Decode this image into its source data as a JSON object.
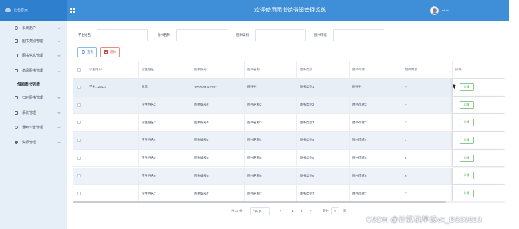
{
  "header": {
    "brand": "后台首页",
    "title": "欢迎使用图书馆借阅管理系统",
    "username": "admin",
    "grid_icon": "grid-icon",
    "avatar_icon": "user-avatar"
  },
  "sidebar": {
    "items": [
      {
        "label": "系统用户",
        "icon": "person-icon"
      },
      {
        "label": "图书类别管理",
        "icon": "edit-icon"
      },
      {
        "label": "图书信息管理",
        "icon": "edit-icon"
      },
      {
        "label": "借阅图书管理",
        "icon": "edit-icon"
      },
      {
        "label": "借阅图书列表",
        "icon": ""
      },
      {
        "label": "归还图书管理",
        "icon": "edit-icon"
      },
      {
        "label": "系统管理",
        "icon": "image-icon"
      },
      {
        "label": "通知公告管理",
        "icon": "info-icon"
      },
      {
        "label": "资源管理",
        "icon": "pin-icon"
      }
    ]
  },
  "search": {
    "fields": [
      {
        "label": "学生姓名",
        "value": ""
      },
      {
        "label": "图书名称",
        "value": ""
      },
      {
        "label": "图书类别",
        "value": ""
      },
      {
        "label": "图书作者",
        "value": ""
      }
    ],
    "search_label": "查询",
    "delete_label": "删除"
  },
  "table": {
    "columns": [
      "学生用户",
      "学生姓名",
      "图书编号",
      "图书名称",
      "图书类别",
      "图书作者",
      "借阅数量",
      "操作"
    ],
    "rows": [
      {
        "user": "学生:123123",
        "name": "张三",
        "code": "1707034462797",
        "book": "柳寻谷",
        "category": "图书类别1",
        "author": "柳寻谷",
        "qty": "3"
      },
      {
        "user": "",
        "name": "学生姓名2",
        "code": "图书编号2",
        "book": "图书名称2",
        "category": "图书类别2",
        "author": "图书作者2",
        "qty": "2"
      },
      {
        "user": "",
        "name": "学生姓名3",
        "code": "图书编号3",
        "book": "图书名称3",
        "category": "图书类别3",
        "author": "图书作者3",
        "qty": "3"
      },
      {
        "user": "",
        "name": "学生姓名4",
        "code": "图书编号4",
        "book": "图书名称4",
        "category": "图书类别4",
        "author": "图书作者4",
        "qty": "4"
      },
      {
        "user": "",
        "name": "学生姓名5",
        "code": "图书编号5",
        "book": "图书名称5",
        "category": "图书类别5",
        "author": "图书作者5",
        "qty": "5"
      },
      {
        "user": "",
        "name": "学生姓名6",
        "code": "图书编号6",
        "book": "图书名称6",
        "category": "图书类别6",
        "author": "图书作者6",
        "qty": "6"
      },
      {
        "user": "",
        "name": "学生姓名7",
        "code": "图书编号7",
        "book": "图书名称7",
        "category": "图书类别7",
        "author": "图书作者7",
        "qty": "7"
      }
    ],
    "detail_label": "详情"
  },
  "pager": {
    "total": "共 13 条",
    "size": "7条/页",
    "prev": "‹",
    "pages": [
      "1",
      "2"
    ],
    "next": "›",
    "goto": "前往",
    "current": "1",
    "page_unit": "页"
  },
  "watermark": "CSDN @计算机毕设vx_BS30813",
  "colors": {
    "topbar": "#3f8fd8",
    "sidebar": "#e6eef8",
    "accent": "#3c7fd6",
    "danger": "#d9463c",
    "success": "#4ea556"
  }
}
